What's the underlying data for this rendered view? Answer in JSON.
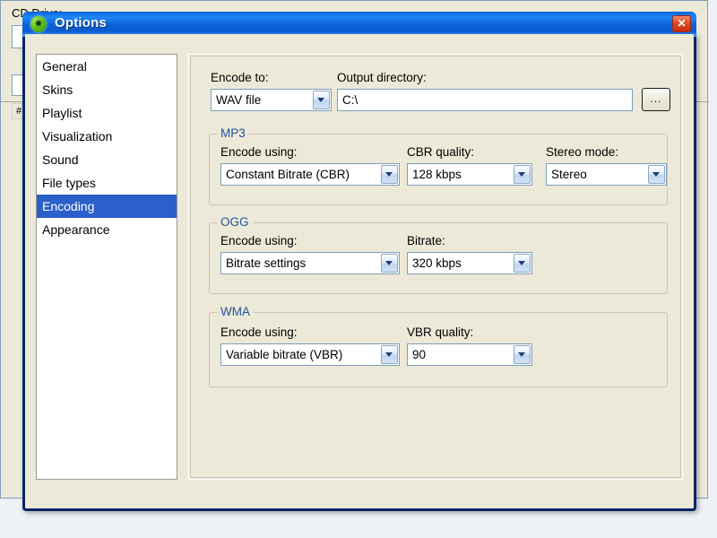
{
  "background_window": {
    "cd_drive_label": "CD Drive:",
    "list_header_hash": "#"
  },
  "dialog": {
    "title": "Options",
    "icon": "green-disc-icon",
    "close_icon": "close-icon",
    "accent_title_color": "#0b62d8",
    "selection_color": "#2b5fc9",
    "group_label_color": "#21539b"
  },
  "sidebar": {
    "items": [
      {
        "label": "General",
        "selected": false
      },
      {
        "label": "Skins",
        "selected": false
      },
      {
        "label": "Playlist",
        "selected": false
      },
      {
        "label": "Visualization",
        "selected": false
      },
      {
        "label": "Sound",
        "selected": false
      },
      {
        "label": "File types",
        "selected": false
      },
      {
        "label": "Encoding",
        "selected": true
      },
      {
        "label": "Appearance",
        "selected": false
      }
    ]
  },
  "pane": {
    "encode_to": {
      "label": "Encode to:",
      "value": "WAV file"
    },
    "output_directory": {
      "label": "Output directory:",
      "value": "C:\\",
      "browse_label": "..."
    },
    "mp3": {
      "title": "MP3",
      "encode_using": {
        "label": "Encode using:",
        "value": "Constant Bitrate (CBR)"
      },
      "cbr_quality": {
        "label": "CBR quality:",
        "value": "128 kbps"
      },
      "stereo_mode": {
        "label": "Stereo mode:",
        "value": "Stereo"
      }
    },
    "ogg": {
      "title": "OGG",
      "encode_using": {
        "label": "Encode using:",
        "value": "Bitrate settings"
      },
      "bitrate": {
        "label": "Bitrate:",
        "value": "320 kbps"
      }
    },
    "wma": {
      "title": "WMA",
      "encode_using": {
        "label": "Encode using:",
        "value": "Variable bitrate (VBR)"
      },
      "vbr_quality": {
        "label": "VBR quality:",
        "value": "90"
      }
    }
  }
}
